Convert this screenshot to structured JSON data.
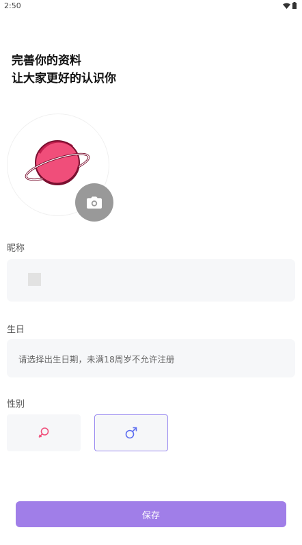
{
  "status_bar": {
    "time": "2:50",
    "icons": [
      "wifi-icon",
      "battery-icon"
    ]
  },
  "header": {
    "line1": "完善你的资料",
    "line2": "让大家更好的认识你"
  },
  "avatar": {
    "image_icon": "planet-icon",
    "camera_icon": "camera-icon"
  },
  "nickname": {
    "label": "昵称",
    "value": ""
  },
  "birthday": {
    "label": "生日",
    "placeholder": "请选择出生日期，未满18周岁不允许注册"
  },
  "gender": {
    "label": "性别",
    "options": [
      {
        "icon": "female-icon",
        "color": "#f04e7a",
        "selected": false
      },
      {
        "icon": "male-icon",
        "color": "#5b6cf0",
        "selected": true
      }
    ]
  },
  "actions": {
    "save_label": "保存"
  },
  "colors": {
    "accent": "#a07ee8",
    "selected_border": "#9b8cf0",
    "input_bg": "#f6f7f9",
    "planet": "#f04e7a"
  }
}
